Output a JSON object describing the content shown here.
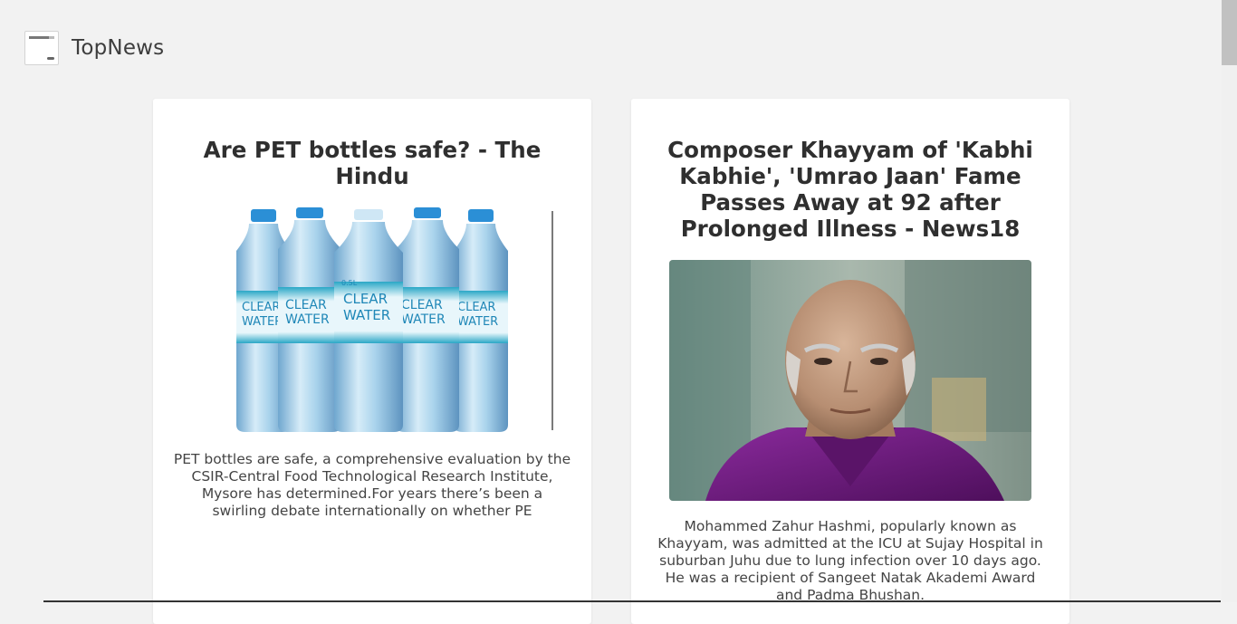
{
  "header": {
    "icon": "browser-window-icon",
    "title": "TopNews"
  },
  "articles": [
    {
      "title": "Are PET bottles safe? - The Hindu",
      "image_alt": "Row of plastic water bottles labeled CLEAR WATER",
      "bottle_label_lines": [
        "CLEAR",
        "WATER"
      ],
      "bottle_size": "0.5L",
      "description": "PET bottles are safe, a comprehensive evaluation by the CSIR-Central Food Technological Research Institute, Mysore has determined.For years there’s been a swirling debate internationally on whether PE"
    },
    {
      "title": "Composer Khayyam of 'Kabhi Kabhie', 'Umrao Jaan' Fame Passes Away at 92 after Prolonged Illness - News18",
      "image_alt": "Portrait of composer Khayyam in a purple shirt",
      "description": "Mohammed Zahur Hashmi, popularly known as Khayyam, was admitted at the ICU at Sujay Hospital in suburban Juhu due to lung infection over 10 days ago. He was a recipient of Sangeet Natak Akademi Award and Padma Bhushan."
    }
  ],
  "colors": {
    "background": "#f2f2f2",
    "card": "#ffffff",
    "text": "#333333",
    "water": "#9fd0ea",
    "label": "#23a9c8",
    "shirt": "#6a1a7a"
  }
}
